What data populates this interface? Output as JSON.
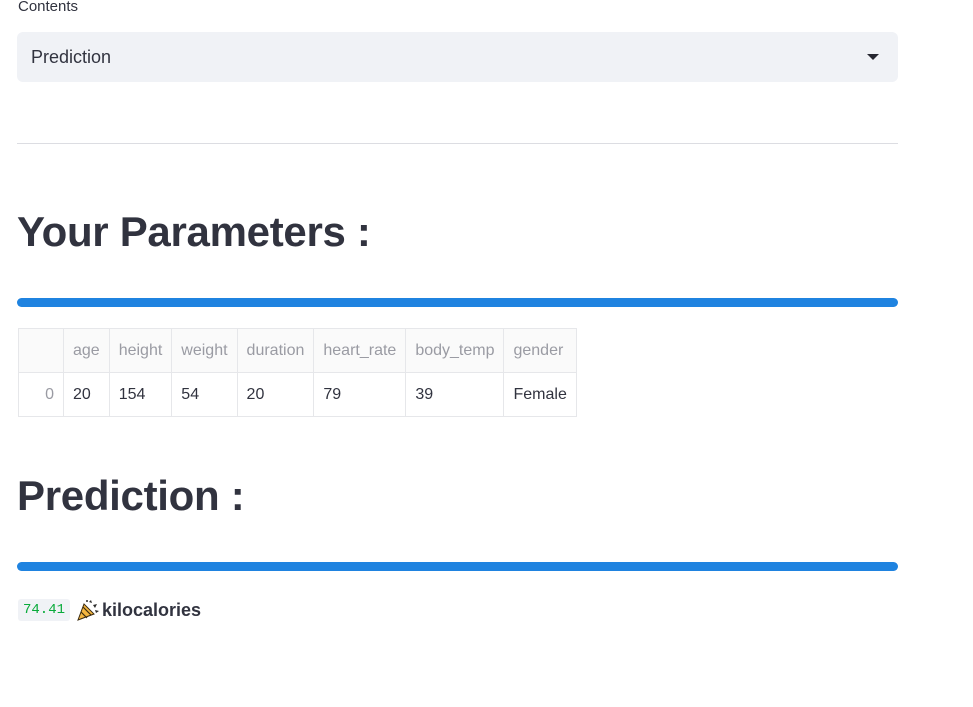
{
  "sidebar_select": {
    "label": "Contents",
    "value": "Prediction"
  },
  "parameters": {
    "heading": "Your Parameters :",
    "progress": 100,
    "table": {
      "columns": [
        "age",
        "height",
        "weight",
        "duration",
        "heart_rate",
        "body_temp",
        "gender"
      ],
      "rows": [
        {
          "index": "0",
          "cells": [
            "20",
            "154",
            "54",
            "20",
            "79",
            "39",
            "Female"
          ]
        }
      ]
    }
  },
  "prediction": {
    "heading": "Prediction :",
    "progress": 100,
    "value": "74.41",
    "icon": "party-popper-icon",
    "unit": "kilocalories"
  },
  "colors": {
    "progress_bar": "#1f83e0",
    "value_text": "#09ab3b",
    "select_bg": "#f0f2f6"
  }
}
